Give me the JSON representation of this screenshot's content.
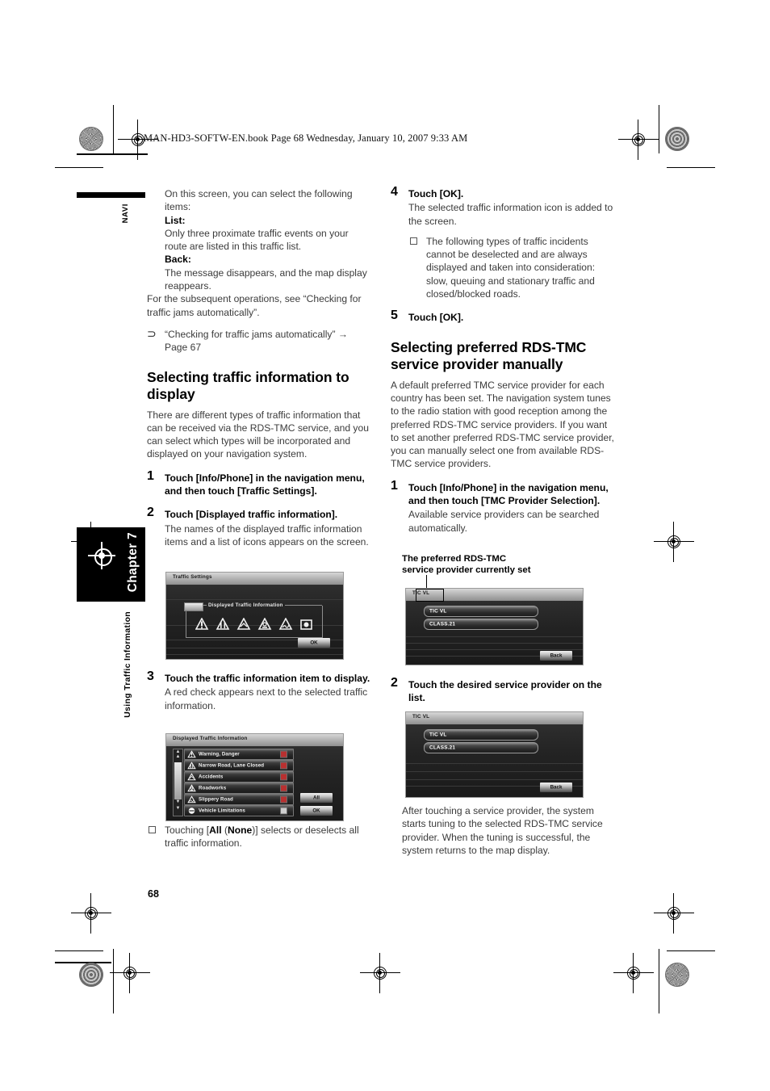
{
  "header": {
    "file_info": "MAN-HD3-SOFTW-EN.book  Page 68  Wednesday, January 10, 2007  9:33 AM"
  },
  "sidebar": {
    "navi_label": "NAVI",
    "chapter_label": "Chapter 7",
    "section_title": "Using Traffic Information",
    "page_number": "68"
  },
  "left_column": {
    "intro_line1": "On this screen, you can select the following items:",
    "list_term": "List:",
    "list_desc": "Only three proximate traffic events on your route are listed in this traffic list.",
    "back_term": "Back:",
    "back_desc": "The message disappears, and the map display reappears.",
    "subsequent": "For the subsequent operations, see “Checking for traffic jams automatically”.",
    "reference": "“Checking for traffic jams automatically” → Page 67",
    "reference_glyph": "⊃",
    "heading": "Selecting traffic information to display",
    "heading_body": "There are different types of traffic information that can be received via the RDS-TMC service, and you can select which types will be incorporated and displayed on your navigation system.",
    "steps": [
      {
        "num": "1",
        "title": "Touch [Info/Phone] in the navigation menu, and then touch [Traffic Settings].",
        "body": ""
      },
      {
        "num": "2",
        "title": "Touch [Displayed traffic information].",
        "body": "The names of the displayed traffic information items and a list of icons appears on the screen."
      },
      {
        "num": "3",
        "title": "Touch the traffic information item to display.",
        "body": "A red check appears next to the selected traffic information."
      }
    ],
    "note_all": {
      "pre": "Touching [",
      "bold1": "All",
      "mid": " (",
      "bold2": "None",
      "post": ")] selects or deselects all traffic information."
    }
  },
  "right_column": {
    "steps": [
      {
        "num": "4",
        "title": "Touch [OK].",
        "body": "The selected traffic information icon is added to the screen.",
        "note": "The following types of traffic incidents cannot be deselected and are always displayed and taken into consideration: slow, queuing and stationary traffic and closed/blocked roads."
      },
      {
        "num": "5",
        "title": "Touch [OK].",
        "body": ""
      }
    ],
    "heading": "Selecting preferred RDS-TMC service provider manually",
    "heading_body": "A default preferred TMC service provider for each country has been set. The navigation system tunes to the radio station with good reception among the preferred RDS-TMC service providers. If you want to set another preferred RDS-TMC service provider, you can manually select one from available RDS-TMC service providers.",
    "step1": {
      "num": "1",
      "title": "Touch [Info/Phone] in the navigation menu, and then touch [TMC Provider Selection].",
      "body": "Available service providers can be searched automatically."
    },
    "callout": "The preferred RDS-TMC\nservice provider currently set",
    "callout_line1": "The preferred RDS-TMC",
    "callout_line2": "service provider currently set",
    "step2": {
      "num": "2",
      "title": "Touch the desired service provider on the list.",
      "body": ""
    },
    "closing": "After touching a service provider, the system starts tuning to the selected RDS-TMC service provider. When the tuning is successful, the system returns to the map display."
  },
  "screenshots": {
    "traffic_settings": {
      "title": "Traffic Settings",
      "group_label": "Displayed Traffic Information",
      "ok_button": "OK",
      "icon_count": 6,
      "icon_names": [
        "warning-triangle-icon",
        "warning-triangle-icon",
        "accident-triangle-icon",
        "roadworks-triangle-icon",
        "slippery-triangle-icon",
        "vehicle-limitation-icon"
      ]
    },
    "displayed_traffic_information": {
      "title": "Displayed Traffic Information",
      "rows": [
        {
          "label": "Warning, Danger",
          "checked": true
        },
        {
          "label": "Narrow Road, Lane Closed",
          "checked": true
        },
        {
          "label": "Accidents",
          "checked": true
        },
        {
          "label": "Roadworks",
          "checked": true
        },
        {
          "label": "Slippery Road",
          "checked": true
        },
        {
          "label": "Vehicle Limitations",
          "checked": false
        }
      ],
      "all_button": "All",
      "ok_button": "OK"
    },
    "tmc_provider_1": {
      "title": "TIC VL",
      "rows": [
        "TIC VL",
        "CLASS.21"
      ],
      "back_button": "Back"
    },
    "tmc_provider_2": {
      "title": "TIC VL",
      "rows": [
        "TIC VL",
        "CLASS.21"
      ],
      "back_button": "Back"
    }
  },
  "colors": {
    "text": "#3b3b3b",
    "heading": "#000000",
    "check_red": "#b83030"
  }
}
